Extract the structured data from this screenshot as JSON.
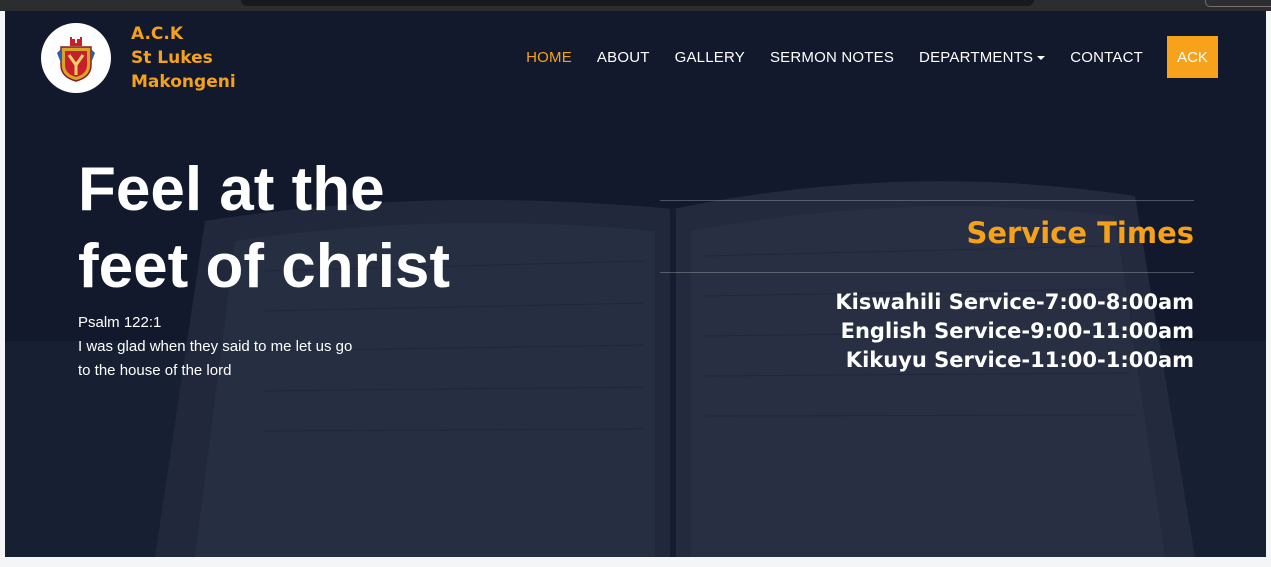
{
  "brand": {
    "line1": "A.C.K",
    "line2": "St Lukes",
    "line3": "Makongeni"
  },
  "nav": {
    "items": [
      {
        "label": "HOME",
        "active": true
      },
      {
        "label": "ABOUT"
      },
      {
        "label": "GALLERY"
      },
      {
        "label": "SERMON NOTES"
      },
      {
        "label": "DEPARTMENTS",
        "dropdown": true
      },
      {
        "label": "CONTACT"
      }
    ],
    "button_label": "ACK"
  },
  "hero": {
    "headline_line1": "Feel at the",
    "headline_line2": "feet of christ",
    "verse_ref": "Psalm 122:1",
    "verse_line1": "I was glad when they said to me let us go",
    "verse_line2": "to the house of the lord"
  },
  "services": {
    "title": "Service Times",
    "items": [
      "Kiswahili Service-7:00-8:00am",
      "English Service-9:00-11:00am",
      "Kikuyu Service-11:00-1:00am"
    ]
  },
  "colors": {
    "accent": "#f5a21a",
    "hero_overlay": "#1a2236",
    "text": "#ffffff"
  }
}
